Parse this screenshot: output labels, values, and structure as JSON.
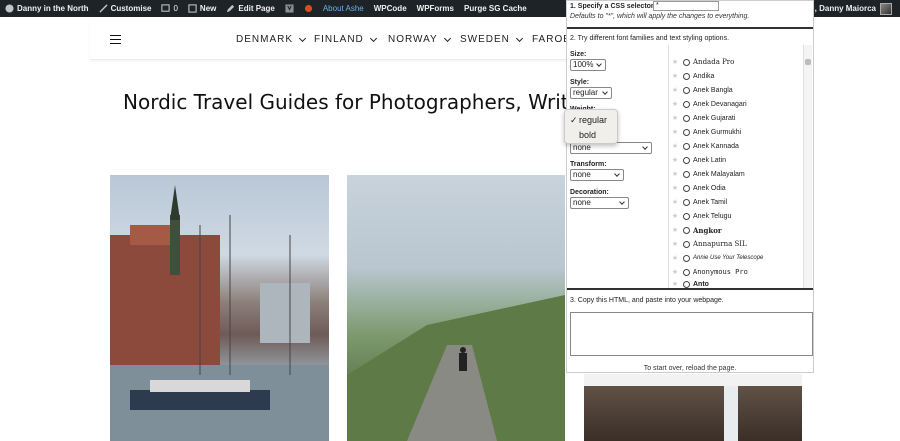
{
  "adminbar": {
    "site_name": "Danny in the North",
    "customise": "Customise",
    "comments_count": "0",
    "new": "New",
    "edit_page": "Edit Page",
    "about": "About Ashe",
    "wpcode": "WPCode",
    "wpforms": "WPForms",
    "purge": "Purge SG Cache",
    "greeting": "i, Danny Maiorca"
  },
  "nav": {
    "items": [
      "DENMARK",
      "FINLAND",
      "NORWAY",
      "SWEDEN",
      "FAROE I"
    ]
  },
  "page_title": "Nordic Travel Guides for Photographers, Written by",
  "panel": {
    "step1": "1. Specify a CSS selector:",
    "selector_value": "*",
    "defaults": "Defaults to \"*\", which will apply the changes to everything.",
    "step2": "2. Try different font families and text styling options.",
    "size_label": "Size:",
    "size_value": "100%",
    "style_label": "Style:",
    "style_value": "regular",
    "weight_label": "Weight:",
    "weight_value": "none",
    "transform_label": "Transform:",
    "transform_value": "none",
    "decoration_label": "Decoration:",
    "decoration_value": "none",
    "step3": "3. Copy this HTML, and paste into your webpage.",
    "restart": "To start over, reload the page.",
    "fonts": [
      "Andada Pro",
      "Andika",
      "Anek Bangla",
      "Anek Devanagari",
      "Anek Gujarati",
      "Anek Gurmukhi",
      "Anek Kannada",
      "Anek Latin",
      "Anek Malayalam",
      "Anek Odia",
      "Anek Tamil",
      "Anek Telugu",
      "Angkor",
      "Annapurna SIL",
      "Annie Use Your Telescope",
      "Anonymous Pro",
      "Anto"
    ]
  },
  "weight_popup": {
    "options": [
      "regular",
      "bold"
    ],
    "selected": "regular"
  },
  "colors": {
    "adminbar_bg": "#1d2327",
    "admin_accent": "#72aee6",
    "orange_dot": "#d54e21"
  }
}
